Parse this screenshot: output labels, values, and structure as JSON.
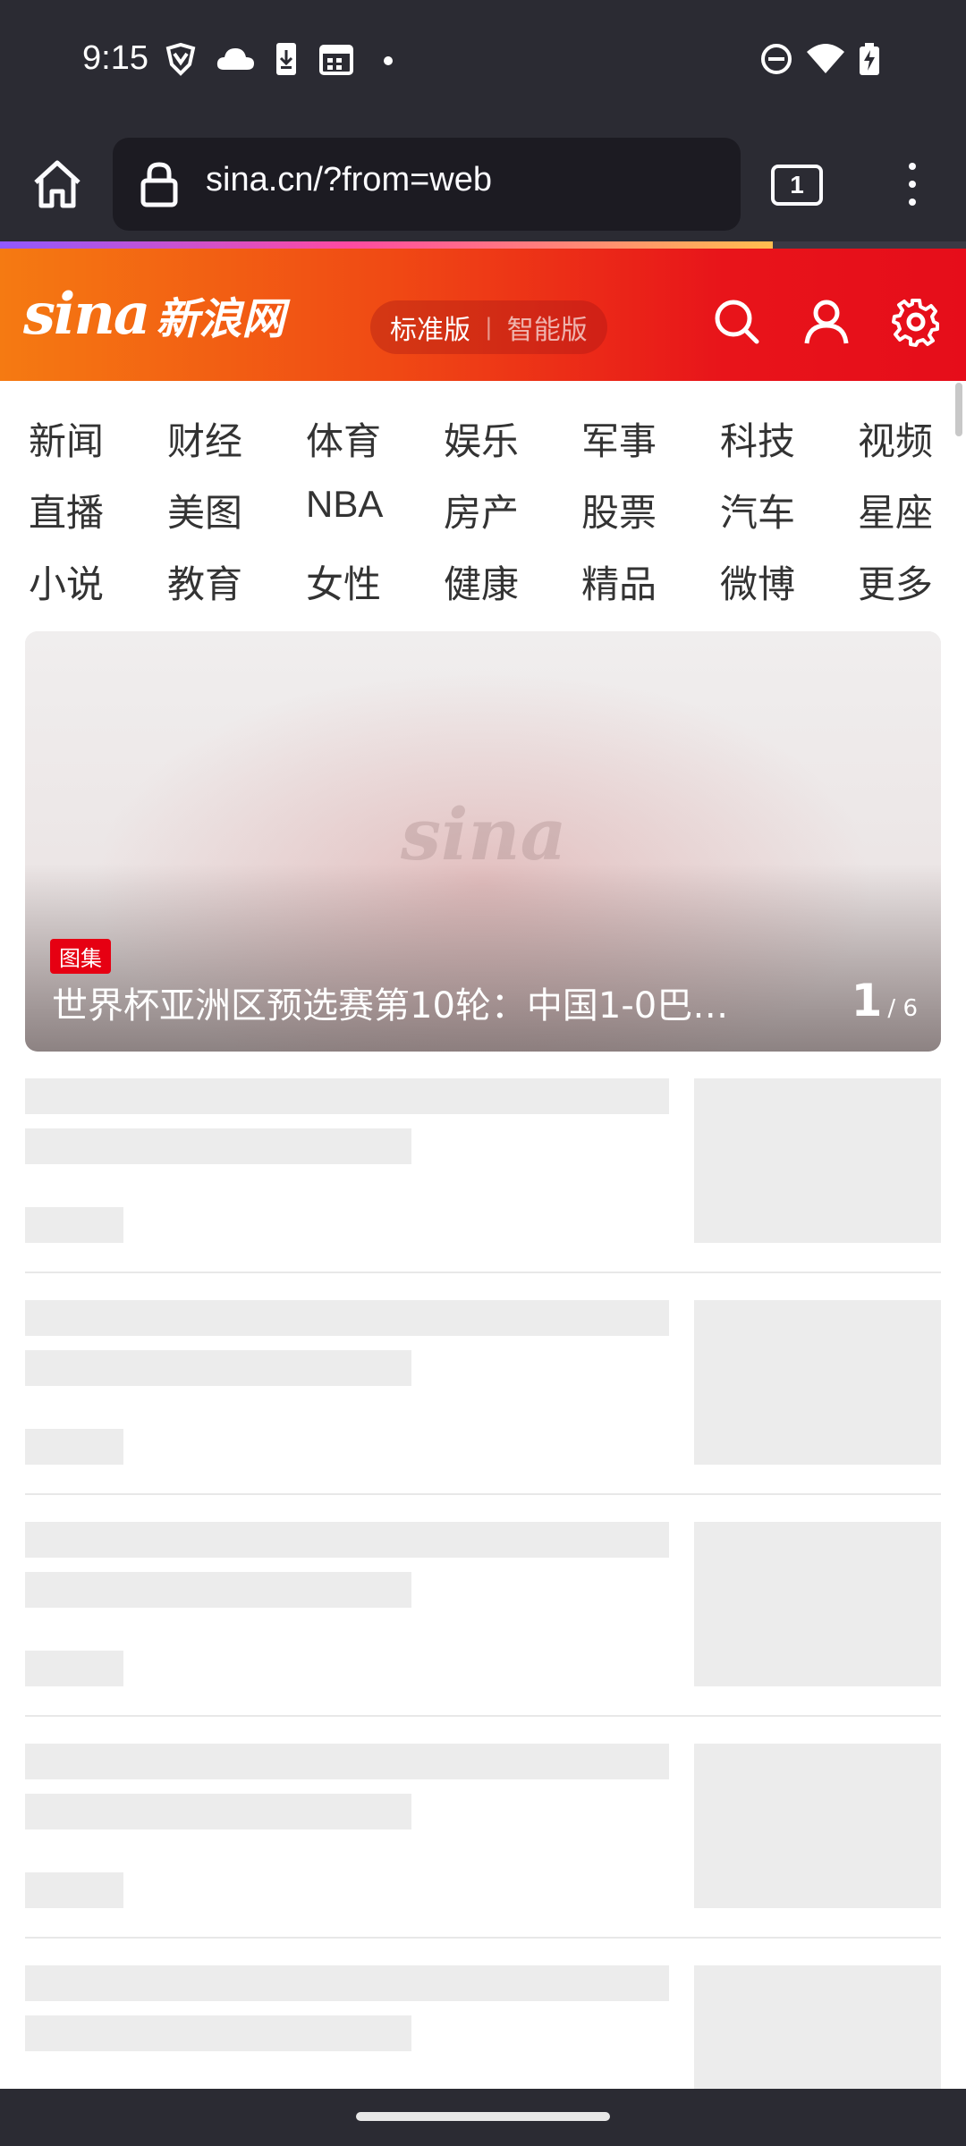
{
  "status_bar": {
    "time": "9:15",
    "left_icons": [
      "vpn-shield-icon",
      "cloud-icon",
      "download-icon",
      "calendar-icon",
      "dot-icon"
    ],
    "right_icons": [
      "do-not-disturb-icon",
      "wifi-icon",
      "battery-charging-icon"
    ]
  },
  "browser": {
    "url": "sina.cn/?from=web",
    "tab_count": "1",
    "load_progress": 0.8
  },
  "header": {
    "logo_word": "sina",
    "logo_cn": "新浪网",
    "version_active": "标准版",
    "version_separator": "|",
    "version_inactive": "智能版"
  },
  "nav": {
    "rows": [
      [
        "新闻",
        "财经",
        "体育",
        "娱乐",
        "军事",
        "科技",
        "视频"
      ],
      [
        "直播",
        "美图",
        "NBA",
        "房产",
        "股票",
        "汽车",
        "星座"
      ],
      [
        "小说",
        "教育",
        "女性",
        "健康",
        "精品",
        "微博",
        "更多"
      ]
    ]
  },
  "carousel": {
    "badge": "图集",
    "caption": "世界杯亚洲区预选赛第10轮：中国1-0巴…",
    "current": "1",
    "total": "/ 6",
    "watermark": "sina"
  },
  "colors": {
    "chrome_bg": "#2b2b33",
    "brand_red": "#e60d1a",
    "brand_orange": "#f57a12",
    "skeleton": "#ececec"
  }
}
